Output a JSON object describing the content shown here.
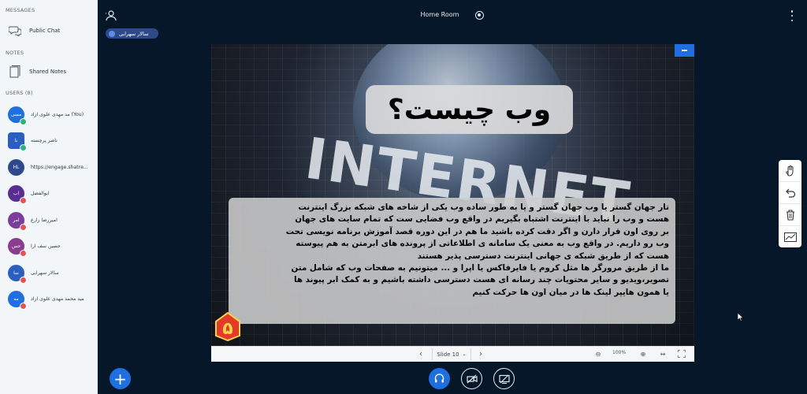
{
  "sidebar": {
    "messages_header": "MESSAGES",
    "public_chat": "Public Chat",
    "notes_header": "NOTES",
    "shared_notes": "Shared Notes",
    "users_header": "USERS (8)",
    "users": [
      {
        "initials": "مسی",
        "name": "مد مهدی علوی آزاد (You)",
        "color": "#1f6fe0",
        "shape": "circle",
        "badge": "#2bb673"
      },
      {
        "initials": "نا",
        "name": "ناصر پرچسته",
        "color": "#2a5fbf",
        "shape": "square",
        "badge": "#2bb673"
      },
      {
        "initials": "HL",
        "name": "https://engage.shatre...",
        "color": "#2e4a8c",
        "shape": "circle",
        "badge": ""
      },
      {
        "initials": "اب",
        "name": "ابوالفضل",
        "color": "#5a2d91",
        "shape": "circle",
        "badge": "#e05656"
      },
      {
        "initials": "امر",
        "name": "امیررضا زارع",
        "color": "#7a3e9d",
        "shape": "circle",
        "badge": "#e05656"
      },
      {
        "initials": "حس",
        "name": "حسین سف آرا",
        "color": "#8a3c8f",
        "shape": "circle",
        "badge": "#e05656"
      },
      {
        "initials": "سا",
        "name": "سالار سهرابی",
        "color": "#2a5fbf",
        "shape": "circle",
        "badge": "#e05656"
      },
      {
        "initials": "مه",
        "name": "مید محمد مهدی علوی آزاد",
        "color": "#1f6fe0",
        "shape": "circle",
        "badge": "#e05656"
      }
    ]
  },
  "topbar": {
    "title": "Home Room",
    "presenter": "سالار سهرابی"
  },
  "slide": {
    "title": "وب چیست؟",
    "background_word": "INTERNET",
    "logo_digit": "۵",
    "body_lines": [
      "تار جهان گستر یا وب جهان گستر و یا به طور ساده وب یکی از شاخه های شبکه بزرگ اینترنت",
      "هست و وب را نباید با اینترنت اشتباه بگیریم در واقع وب فضایی ست که تمام سایت های جهان",
      "بر روی اون قرار دارن و اگر دقت کرده باشید ما هم در این دوره قصد آموزش برنامه نویسی تحت",
      "وب رو داریم. در واقع وب به معنی یک سامانه ی اطلاعاتی از پرونده های ابرمتن به هم پیوسته",
      "هست که از طریق شبکه ی جهانی اینترنت دسترسی پذیر هستند",
      "ما از طریق مرورگر ها مثل کروم یا فایرفاکس یا اپرا و ... میتونیم به صفحات وب که شامل متن",
      "تصویر،ویدیو و سایر محتویات چند رسانه ای هست دسترسی داشته باشیم و به کمک ابر پیوند ها",
      "یا همون هایپر لینک ها در میان اون ها حرکت کنیم"
    ]
  },
  "slide_controls": {
    "slide_label": "Slide 10",
    "zoom": "100%"
  },
  "colors": {
    "background": "#06172a",
    "accent": "#1f6fe0"
  }
}
